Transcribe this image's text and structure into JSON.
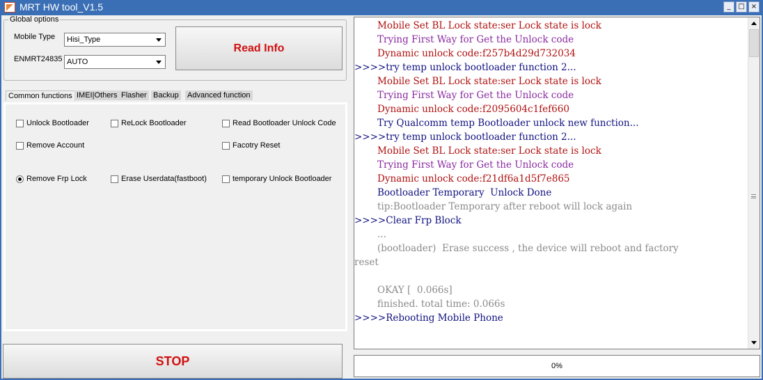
{
  "window": {
    "title": "MRT HW tool_V1.5",
    "minimize": "_",
    "maximize": "□",
    "close": "×",
    "frame_color": "#3a6fb5"
  },
  "global_options": {
    "legend": "Global options",
    "mobile_type_label": "Mobile Type",
    "mobile_type_value": "Hisi_Type",
    "enmrt_label": "ENMRT24835",
    "enmrt_value": "AUTO",
    "read_info_label": "Read Info"
  },
  "tabs": [
    {
      "label": "Common functions",
      "active": true
    },
    {
      "label": "IMEI|Others",
      "active": false
    },
    {
      "label": "Flasher",
      "active": false
    },
    {
      "label": "Backup",
      "active": false
    },
    {
      "label": "Advanced function",
      "active": false
    }
  ],
  "options": {
    "unlock_bootloader": {
      "label": "Unlock Bootloader",
      "checked": false
    },
    "relock_bootloader": {
      "label": "ReLock Bootloader",
      "checked": false
    },
    "read_bootloader_unlock_code": {
      "label": "Read Bootloader Unlock Code",
      "checked": false
    },
    "remove_account": {
      "label": "Remove Account",
      "checked": false
    },
    "factory_reset": {
      "label": "Facotry Reset",
      "checked": false
    },
    "remove_frp_lock": {
      "label": "Remove Frp Lock",
      "checked": true
    },
    "erase_userdata": {
      "label": "Erase Userdata(fastboot)",
      "checked": false
    },
    "temporary_unlock_bootloader": {
      "label": "temporary Unlock Bootloader",
      "checked": false
    }
  },
  "stop_label": "STOP",
  "log": {
    "lines": [
      {
        "text": "Mobile Set BL Lock state:ser Lock state is lock",
        "color": "red",
        "indent": true
      },
      {
        "text": "Trying First Way for Get the Unlock code",
        "color": "purple",
        "indent": true
      },
      {
        "text": "Dynamic unlock code:f257b4d29d732034",
        "color": "red",
        "indent": true
      },
      {
        "text": ">>>>try temp unlock bootloader function 2...",
        "color": "navy",
        "indent": false
      },
      {
        "text": "Mobile Set BL Lock state:ser Lock state is lock",
        "color": "red",
        "indent": true
      },
      {
        "text": "Trying First Way for Get the Unlock code",
        "color": "purple",
        "indent": true
      },
      {
        "text": "Dynamic unlock code:f2095604c1fef660",
        "color": "red",
        "indent": true
      },
      {
        "text": "Try Qualcomm temp Bootloader unlock new function...",
        "color": "navy",
        "indent": true
      },
      {
        "text": ">>>>try temp unlock bootloader function 2...",
        "color": "navy",
        "indent": false
      },
      {
        "text": "Mobile Set BL Lock state:ser Lock state is lock",
        "color": "red",
        "indent": true
      },
      {
        "text": "Trying First Way for Get the Unlock code",
        "color": "purple",
        "indent": true
      },
      {
        "text": "Dynamic unlock code:f21df6a1d5f7e865",
        "color": "red",
        "indent": true
      },
      {
        "text": "Bootloader Temporary  Unlock Done",
        "color": "navy",
        "indent": true
      },
      {
        "text": "tip:Bootloader Temporary after reboot will lock again",
        "color": "gray",
        "indent": true
      },
      {
        "text": ">>>>Clear Frp Block",
        "color": "navy",
        "indent": false
      },
      {
        "text": "...",
        "color": "gray",
        "indent": true
      },
      {
        "text": "(bootloader)  Erase success , the device will reboot and factory",
        "color": "gray",
        "indent": true
      },
      {
        "text": "reset",
        "color": "gray",
        "indent": false
      },
      {
        "text": "",
        "color": "gray",
        "indent": false
      },
      {
        "text": "OKAY [  0.066s]",
        "color": "gray",
        "indent": true
      },
      {
        "text": "finished. total time: 0.066s",
        "color": "gray",
        "indent": true
      },
      {
        "text": ">>>>Rebooting Mobile Phone",
        "color": "navy",
        "indent": false
      }
    ],
    "colors": {
      "red": "#b01010",
      "purple": "#8a2aa0",
      "navy": "#101080",
      "gray": "#8a8a8a"
    }
  },
  "progress": {
    "value": 0,
    "label": "0%"
  }
}
